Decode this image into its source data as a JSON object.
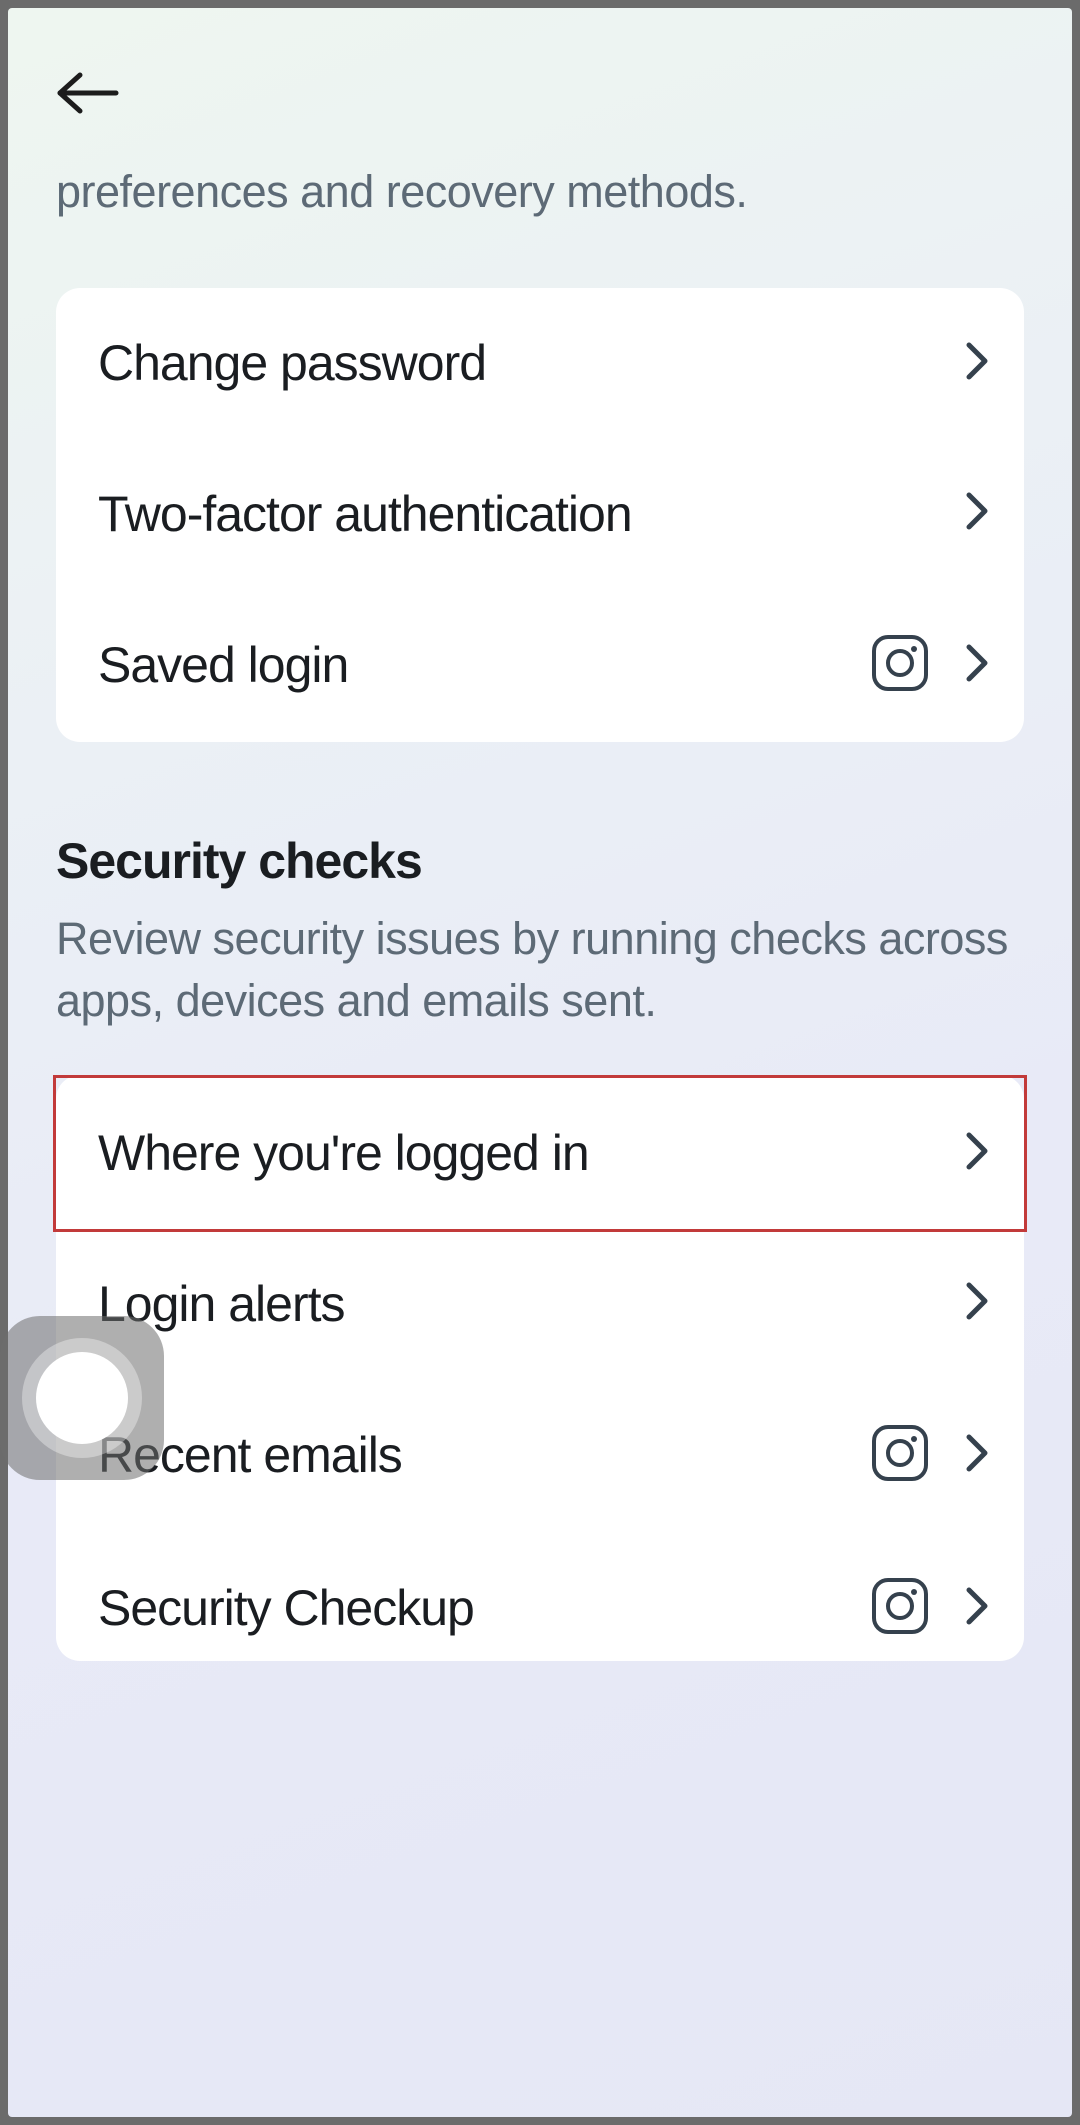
{
  "header": {
    "subtitle": "preferences and recovery methods."
  },
  "login_security": {
    "items": [
      {
        "label": "Change password",
        "has_ig_icon": false
      },
      {
        "label": "Two-factor authentication",
        "has_ig_icon": false
      },
      {
        "label": "Saved login",
        "has_ig_icon": true
      }
    ]
  },
  "security_checks": {
    "title": "Security checks",
    "description": "Review security issues by running checks across apps, devices and emails sent.",
    "items": [
      {
        "label": "Where you're logged in",
        "has_ig_icon": false,
        "highlighted": true
      },
      {
        "label": "Login alerts",
        "has_ig_icon": false
      },
      {
        "label": "Recent emails",
        "has_ig_icon": true
      },
      {
        "label": "Security Checkup",
        "has_ig_icon": true
      }
    ]
  }
}
